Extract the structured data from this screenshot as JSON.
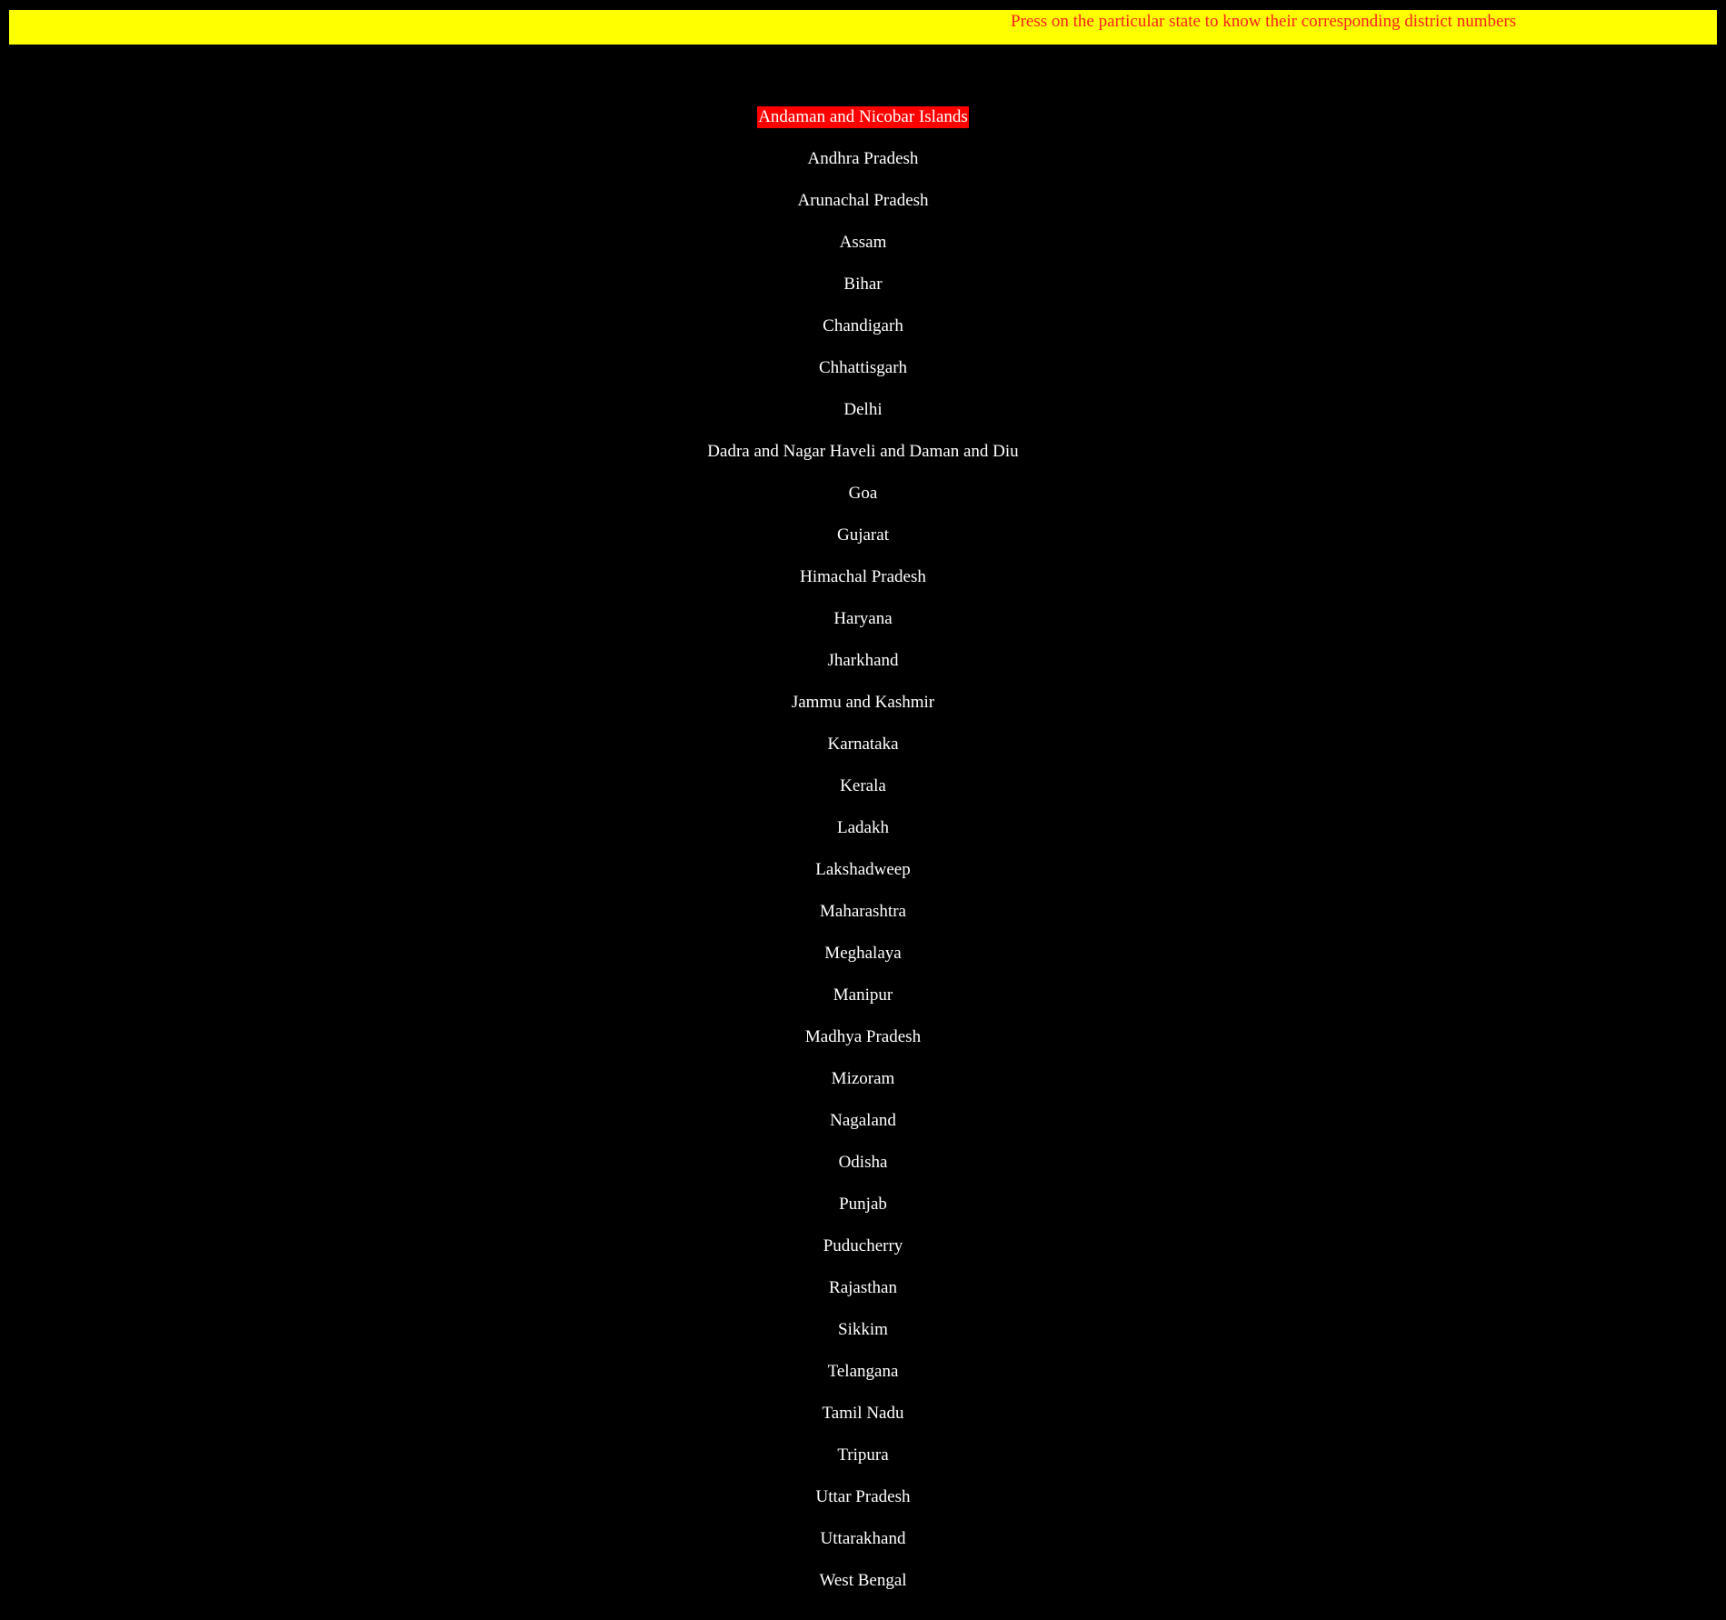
{
  "banner": {
    "text": "Press on the particular state to know their corresponding district numbers",
    "background_color": "#ffff00",
    "text_color": "#ff2020"
  },
  "states": {
    "selected_index": 0,
    "selected_color": "#ff0000",
    "items": [
      "Andaman and Nicobar Islands",
      "Andhra Pradesh",
      "Arunachal Pradesh",
      "Assam",
      "Bihar",
      "Chandigarh",
      "Chhattisgarh",
      "Delhi",
      "Dadra and Nagar Haveli and Daman and Diu",
      "Goa",
      "Gujarat",
      "Himachal Pradesh",
      "Haryana",
      "Jharkhand",
      "Jammu and Kashmir",
      "Karnataka",
      "Kerala",
      "Ladakh",
      "Lakshadweep",
      "Maharashtra",
      "Meghalaya",
      "Manipur",
      "Madhya Pradesh",
      "Mizoram",
      "Nagaland",
      "Odisha",
      "Punjab",
      "Puducherry",
      "Rajasthan",
      "Sikkim",
      "Telangana",
      "Tamil Nadu",
      "Tripura",
      "Uttar Pradesh",
      "Uttarakhand",
      "West Bengal"
    ]
  }
}
